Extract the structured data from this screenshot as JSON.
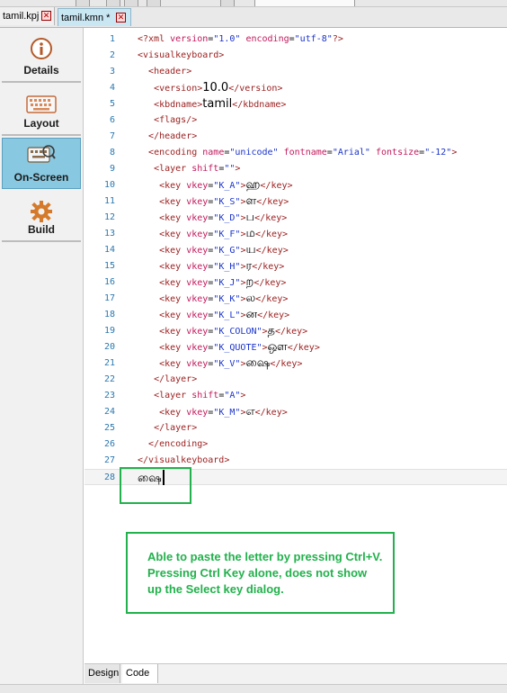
{
  "file_tabs": [
    {
      "label": "tamil.kpj",
      "active": false
    },
    {
      "label": "tamil.kmn *",
      "active": true
    }
  ],
  "sidebar": {
    "items": [
      {
        "label": "Details",
        "icon": "info-icon",
        "active": false
      },
      {
        "label": "Layout",
        "icon": "keyboard-icon",
        "active": false
      },
      {
        "label": "On-Screen",
        "icon": "onscreen-keyboard-icon",
        "active": true
      },
      {
        "label": "Build",
        "icon": "gear-icon",
        "active": false
      }
    ]
  },
  "editor": {
    "lines": [
      {
        "n": "1",
        "parts": [
          [
            "t",
            "<?xml "
          ],
          [
            "a",
            "version"
          ],
          [
            "x",
            "="
          ],
          [
            "v",
            "\"1.0\""
          ],
          [
            "x",
            " "
          ],
          [
            "a",
            "encoding"
          ],
          [
            "x",
            "="
          ],
          [
            "v",
            "\"utf-8\""
          ],
          [
            "t",
            "?>"
          ]
        ]
      },
      {
        "n": "2",
        "parts": [
          [
            "t",
            "<visualkeyboard>"
          ]
        ]
      },
      {
        "n": "3",
        "parts": [
          [
            "x",
            "  "
          ],
          [
            "t",
            "<header>"
          ]
        ]
      },
      {
        "n": "4",
        "parts": [
          [
            "x",
            "   "
          ],
          [
            "t",
            "<version>"
          ],
          [
            "big",
            "10.0"
          ],
          [
            "t",
            "</version>"
          ]
        ]
      },
      {
        "n": "5",
        "parts": [
          [
            "x",
            "   "
          ],
          [
            "t",
            "<kbdname>"
          ],
          [
            "big",
            "tamil"
          ],
          [
            "t",
            "</kbdname>"
          ]
        ]
      },
      {
        "n": "6",
        "parts": [
          [
            "x",
            "   "
          ],
          [
            "t",
            "<flags/>"
          ]
        ]
      },
      {
        "n": "7",
        "parts": [
          [
            "x",
            "  "
          ],
          [
            "t",
            "</header>"
          ]
        ]
      },
      {
        "n": "8",
        "parts": [
          [
            "x",
            "  "
          ],
          [
            "t",
            "<encoding "
          ],
          [
            "a",
            "name"
          ],
          [
            "x",
            "="
          ],
          [
            "v",
            "\"unicode\""
          ],
          [
            "x",
            " "
          ],
          [
            "a",
            "fontname"
          ],
          [
            "x",
            "="
          ],
          [
            "v",
            "\"Arial\""
          ],
          [
            "x",
            " "
          ],
          [
            "a",
            "fontsize"
          ],
          [
            "x",
            "="
          ],
          [
            "v",
            "\"-12\""
          ],
          [
            "t",
            ">"
          ]
        ]
      },
      {
        "n": "9",
        "parts": [
          [
            "x",
            "   "
          ],
          [
            "t",
            "<layer "
          ],
          [
            "a",
            "shift"
          ],
          [
            "x",
            "="
          ],
          [
            "v",
            "\"\""
          ],
          [
            "t",
            ">"
          ]
        ]
      },
      {
        "n": "10",
        "parts": [
          [
            "x",
            "    "
          ],
          [
            "t",
            "<key "
          ],
          [
            "a",
            "vkey"
          ],
          [
            "x",
            "="
          ],
          [
            "v",
            "\"K_A\""
          ],
          [
            "t",
            ">"
          ],
          [
            "big",
            "ஹ"
          ],
          [
            "t",
            "</key>"
          ]
        ]
      },
      {
        "n": "11",
        "parts": [
          [
            "x",
            "    "
          ],
          [
            "t",
            "<key "
          ],
          [
            "a",
            "vkey"
          ],
          [
            "x",
            "="
          ],
          [
            "v",
            "\"K_S\""
          ],
          [
            "t",
            ">"
          ],
          [
            "big",
            "ள"
          ],
          [
            "t",
            "</key>"
          ]
        ]
      },
      {
        "n": "12",
        "parts": [
          [
            "x",
            "    "
          ],
          [
            "t",
            "<key "
          ],
          [
            "a",
            "vkey"
          ],
          [
            "x",
            "="
          ],
          [
            "v",
            "\"K_D\""
          ],
          [
            "t",
            ">"
          ],
          [
            "big",
            "ப"
          ],
          [
            "t",
            "</key>"
          ]
        ]
      },
      {
        "n": "13",
        "parts": [
          [
            "x",
            "    "
          ],
          [
            "t",
            "<key "
          ],
          [
            "a",
            "vkey"
          ],
          [
            "x",
            "="
          ],
          [
            "v",
            "\"K_F\""
          ],
          [
            "t",
            ">"
          ],
          [
            "big",
            "ம"
          ],
          [
            "t",
            "</key>"
          ]
        ]
      },
      {
        "n": "14",
        "parts": [
          [
            "x",
            "    "
          ],
          [
            "t",
            "<key "
          ],
          [
            "a",
            "vkey"
          ],
          [
            "x",
            "="
          ],
          [
            "v",
            "\"K_G\""
          ],
          [
            "t",
            ">"
          ],
          [
            "big",
            "ய"
          ],
          [
            "t",
            "</key>"
          ]
        ]
      },
      {
        "n": "15",
        "parts": [
          [
            "x",
            "    "
          ],
          [
            "t",
            "<key "
          ],
          [
            "a",
            "vkey"
          ],
          [
            "x",
            "="
          ],
          [
            "v",
            "\"K_H\""
          ],
          [
            "t",
            ">"
          ],
          [
            "big",
            "ர"
          ],
          [
            "t",
            "</key>"
          ]
        ]
      },
      {
        "n": "16",
        "parts": [
          [
            "x",
            "    "
          ],
          [
            "t",
            "<key "
          ],
          [
            "a",
            "vkey"
          ],
          [
            "x",
            "="
          ],
          [
            "v",
            "\"K_J\""
          ],
          [
            "t",
            ">"
          ],
          [
            "big",
            "ற"
          ],
          [
            "t",
            "</key>"
          ]
        ]
      },
      {
        "n": "17",
        "parts": [
          [
            "x",
            "    "
          ],
          [
            "t",
            "<key "
          ],
          [
            "a",
            "vkey"
          ],
          [
            "x",
            "="
          ],
          [
            "v",
            "\"K_K\""
          ],
          [
            "t",
            ">"
          ],
          [
            "big",
            "ல"
          ],
          [
            "t",
            "</key>"
          ]
        ]
      },
      {
        "n": "18",
        "parts": [
          [
            "x",
            "    "
          ],
          [
            "t",
            "<key "
          ],
          [
            "a",
            "vkey"
          ],
          [
            "x",
            "="
          ],
          [
            "v",
            "\"K_L\""
          ],
          [
            "t",
            ">"
          ],
          [
            "big",
            "ன"
          ],
          [
            "t",
            "</key>"
          ]
        ]
      },
      {
        "n": "19",
        "parts": [
          [
            "x",
            "    "
          ],
          [
            "t",
            "<key "
          ],
          [
            "a",
            "vkey"
          ],
          [
            "x",
            "="
          ],
          [
            "v",
            "\"K_COLON\""
          ],
          [
            "t",
            ">"
          ],
          [
            "big",
            "த"
          ],
          [
            "t",
            "</key>"
          ]
        ]
      },
      {
        "n": "20",
        "parts": [
          [
            "x",
            "    "
          ],
          [
            "t",
            "<key "
          ],
          [
            "a",
            "vkey"
          ],
          [
            "x",
            "="
          ],
          [
            "v",
            "\"K_QUOTE\""
          ],
          [
            "t",
            ">"
          ],
          [
            "big",
            "ஔ"
          ],
          [
            "t",
            "</key>"
          ]
        ]
      },
      {
        "n": "21",
        "parts": [
          [
            "x",
            "    "
          ],
          [
            "t",
            "<key "
          ],
          [
            "a",
            "vkey"
          ],
          [
            "x",
            "="
          ],
          [
            "v",
            "\"K_V\""
          ],
          [
            "t",
            ">"
          ],
          [
            "big",
            "ஷை"
          ],
          [
            "t",
            "</key>"
          ]
        ]
      },
      {
        "n": "22",
        "parts": [
          [
            "x",
            "   "
          ],
          [
            "t",
            "</layer>"
          ]
        ]
      },
      {
        "n": "23",
        "parts": [
          [
            "x",
            "   "
          ],
          [
            "t",
            "<layer "
          ],
          [
            "a",
            "shift"
          ],
          [
            "x",
            "="
          ],
          [
            "v",
            "\"A\""
          ],
          [
            "t",
            ">"
          ]
        ]
      },
      {
        "n": "24",
        "parts": [
          [
            "x",
            "    "
          ],
          [
            "t",
            "<key "
          ],
          [
            "a",
            "vkey"
          ],
          [
            "x",
            "="
          ],
          [
            "v",
            "\"K_M\""
          ],
          [
            "t",
            ">"
          ],
          [
            "big",
            "எ"
          ],
          [
            "t",
            "</key>"
          ]
        ]
      },
      {
        "n": "25",
        "parts": [
          [
            "x",
            "   "
          ],
          [
            "t",
            "</layer>"
          ]
        ]
      },
      {
        "n": "26",
        "parts": [
          [
            "x",
            "  "
          ],
          [
            "t",
            "</encoding>"
          ]
        ]
      },
      {
        "n": "27",
        "parts": [
          [
            "t",
            "</visualkeyboard>"
          ]
        ]
      },
      {
        "n": "28",
        "parts": [
          [
            "big",
            "ஷை"
          ]
        ],
        "current": true
      }
    ]
  },
  "annotation": {
    "text": "Able to paste the letter by pressing Ctrl+V. Pressing Ctrl Key alone, does not show up the Select key dialog.",
    "color": "#22b14c"
  },
  "bottom_tabs": [
    "Design",
    "Code"
  ],
  "colors": {
    "tag": "#9b1d1d",
    "attribute": "#c2185b",
    "value": "#1a33cc",
    "line_number": "#2b78b0",
    "active_sidebar": "#88c8e0",
    "active_tab": "#c9e6f3"
  }
}
